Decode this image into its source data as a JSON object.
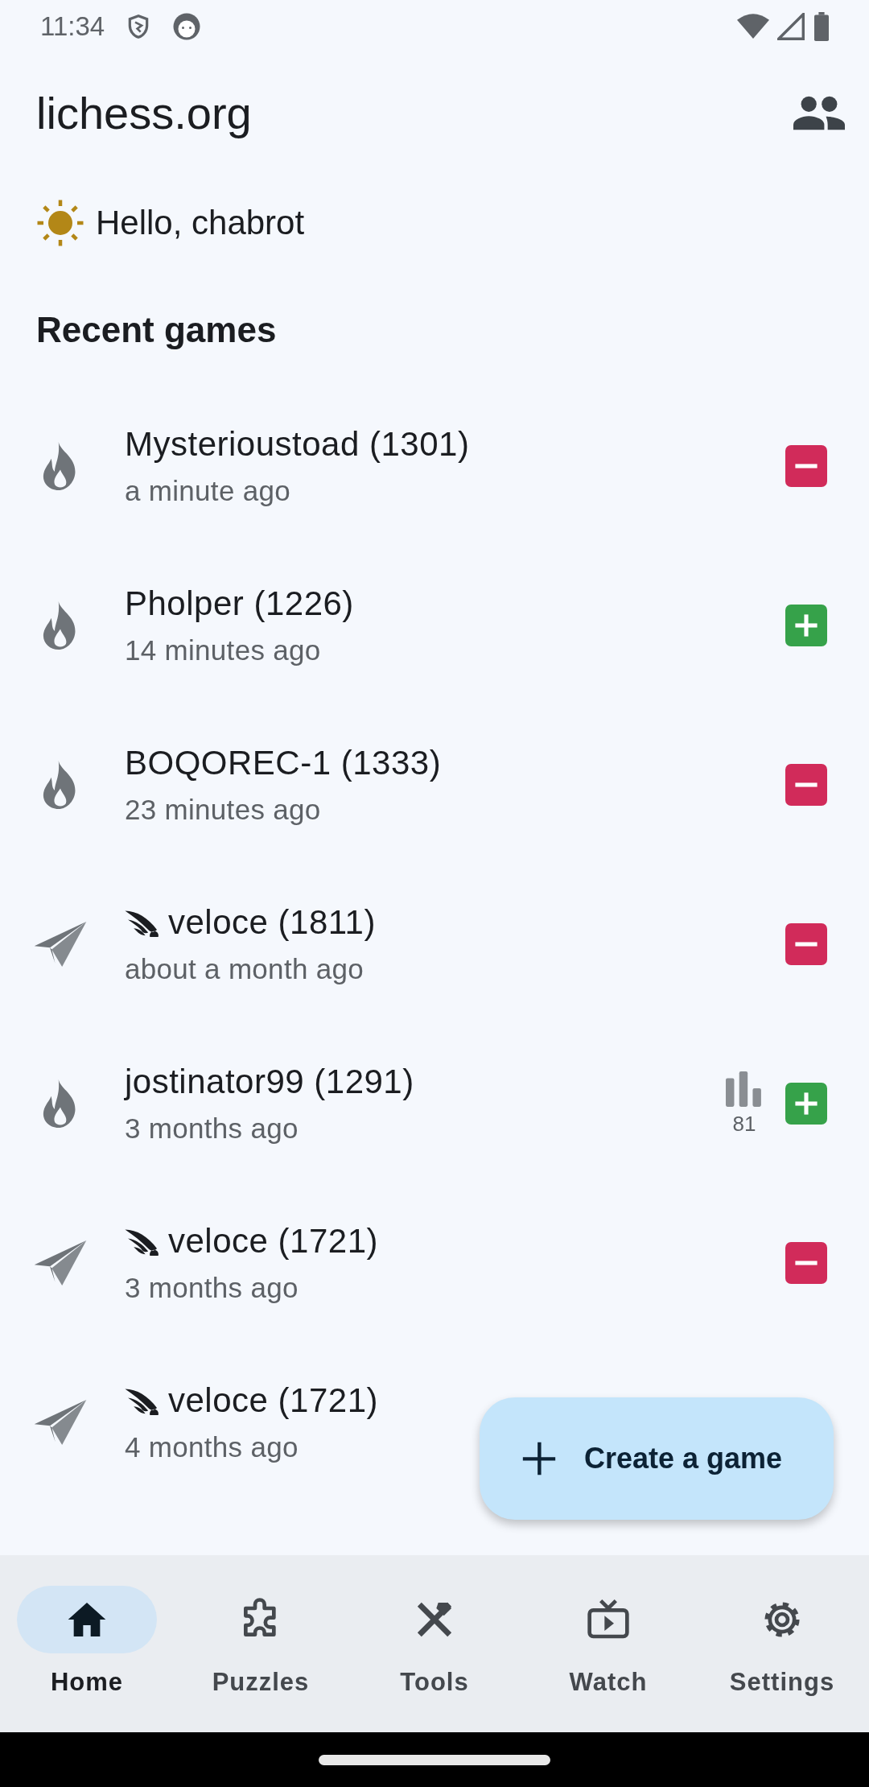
{
  "status_bar": {
    "time": "11:34"
  },
  "app_bar": {
    "title": "lichess.org"
  },
  "greeting": "Hello, chabrot",
  "recent_games": {
    "title": "Recent games",
    "rows": [
      {
        "kind": "flame",
        "bot": false,
        "opponent": "Mysterioustoad (1301)",
        "time": "a minute ago",
        "won": false
      },
      {
        "kind": "flame",
        "bot": false,
        "opponent": "Pholper (1226)",
        "time": "14 minutes ago",
        "won": true
      },
      {
        "kind": "flame",
        "bot": false,
        "opponent": "BOQOREC-1 (1333)",
        "time": "23 minutes ago",
        "won": false
      },
      {
        "kind": "plane",
        "bot": true,
        "opponent": "veloce (1811)",
        "time": "about a month ago",
        "won": false
      },
      {
        "kind": "flame",
        "bot": false,
        "opponent": "jostinator99 (1291)",
        "time": "3 months ago",
        "stat": "81",
        "won": true
      },
      {
        "kind": "plane",
        "bot": true,
        "opponent": "veloce (1721)",
        "time": "3 months ago",
        "won": false
      },
      {
        "kind": "plane",
        "bot": true,
        "opponent": "veloce (1721)",
        "time": "4 months ago"
      }
    ]
  },
  "fab": {
    "label": "Create a game"
  },
  "nav": [
    {
      "kind": "home",
      "label": "Home",
      "selected": true
    },
    {
      "kind": "puzzle",
      "label": "Puzzles",
      "selected": false
    },
    {
      "kind": "tools",
      "label": "Tools",
      "selected": false
    },
    {
      "kind": "watch",
      "label": "Watch",
      "selected": false
    },
    {
      "kind": "settings",
      "label": "Settings",
      "selected": false
    }
  ]
}
